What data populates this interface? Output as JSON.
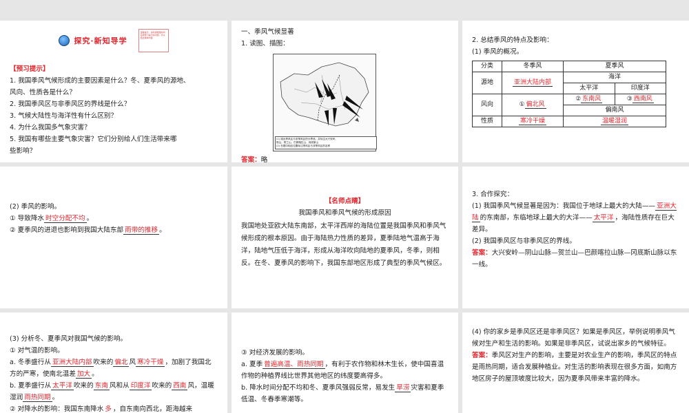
{
  "p1": {
    "title": "探究·新知导学",
    "note": "温馨提示：请利用较短时间完成预习提示的问题，可以结合课本内容",
    "section": "【预习提示】",
    "q": [
      "1. 我国季风气候形成的主要因素是什么？冬、夏季风的源地、",
      "风向、性质各是什么？",
      "2. 我国季风区与非季风区的界线是什么？",
      "3. 气候大陆性与海洋性有什么区别？",
      "4. 为什么我国多气象灾害？",
      "5. 我国有哪些主要气象灾害？它们分别给人们生活带来哪",
      "些影响？"
    ]
  },
  "p2": {
    "h1": "一、季风气候显著",
    "h2": "1. 读图、描图：",
    "map_note": [
      "(1) 描出季风区与非季风区的分界线，并标注大兴安岭、",
      "阴山、贺兰山、巴颜喀拉山、冈底斯山",
      "(2) 在图中相应位置标注季风区与非季风区的名称"
    ],
    "legend": [
      "夏季风",
      "冬季风"
    ],
    "ans_label": "答案：",
    "ans": "略"
  },
  "p3": {
    "h": "2. 总结季风的特点及影响：",
    "sub": "(1) 季风的概况。",
    "t": {
      "c0": "分类",
      "c1": "冬季风",
      "c2": "夏季风",
      "source": "源地",
      "src_w": "亚洲大陆内部",
      "ocean": "海洋",
      "pac": "太平洋",
      "ind": "印度洋",
      "dir": "风向",
      "n1": "①",
      "dir_w": "偏北风",
      "n2": "②",
      "dir_p": "东南风",
      "n3": "③",
      "dir_i": "西南风",
      "dir_s": "偏南风",
      "nature": "性质",
      "nat_w": "寒冷干燥",
      "nat_s": "温暖湿润"
    }
  },
  "p4": {
    "h": "(2) 季风的影响。",
    "l1a": "① 导致降水",
    "l1b": "时空分配不均",
    "l1c": "。",
    "l2a": "② 夏季风的进退也影响到我国大陆东部",
    "l2b": "雨带的推移",
    "l2c": "。"
  },
  "p5": {
    "h": "【名师点睛】",
    "title": "我国季风和季风气候的形成原因",
    "body": "我国地处亚欧大陆东南部，太平洋西岸的海陆位置是我国季风和季风气候形成的根本原因。由于海陆热力性质的差异，夏季陆地气温高于海洋，陆地气压低于海洋，形成从海洋吹向陆地的夏季风，冬季，则相反。在冬、夏季风的影响下，我国东部地区形成了典型的季风气候区。"
  },
  "p6": {
    "h": "3. 合作探究：",
    "q1a": "(1) 我国季风气候显著是因为：我国位于地球上最大的大陆——",
    "q1b": "亚洲大陆",
    "q1c": "的东南部，东临地球上最大的大洋——",
    "q1d": "太平洋",
    "q1e": "，海陆性质存在巨大差异。",
    "q2": "(2) 我国季风区与非季风区的界线。",
    "ans_label": "答案：",
    "ans": "大兴安岭—阴山山脉—贺兰山—巴颜喀拉山脉—冈底斯山脉以东一线。"
  },
  "p7": {
    "h": "(3) 分析冬、夏季风对我国气候的影响。",
    "s1": "① 对气温的影响。",
    "a1": "a. 冬季盛行从",
    "a2": "亚洲大陆内部",
    "a3": "吹来的",
    "a4": "偏北",
    "a5": "风",
    "a6": "寒冷干燥",
    "a7": "，加剧了我国北方的严寒，使南北温差",
    "a8": "加大",
    "a9": "。",
    "b1": "b. 夏季盛行从",
    "b2": "太平洋",
    "b3": "吹来的",
    "b4": "东南",
    "b5": "风和从",
    "b6": "印度洋",
    "b7": "吹来的",
    "b8": "西南",
    "b9": "风，温暖湿润",
    "b10": "雨热同期",
    "b11": "。",
    "c1": "② 对降水的影响：我国东南降水",
    "c2": "多",
    "c3": "，自东南向西北，距海越来"
  },
  "p8": {
    "s": "③ 对经济发展的影响。",
    "a1": "a. 夏季",
    "a2": "普遍高温、雨热同期",
    "a3": "，有利于农作物和林木生长，使中国喜温作物的种植界线比世界其他地区的纬度要高得多。",
    "b1": "b. 降水时间分配不均和冬、夏季风强弱反常，易发生",
    "b2": "旱涝",
    "b3": "灾害和夏季低温、冬春季寒潮等。"
  },
  "p9": {
    "q": "(4) 你的家乡是季风区还是非季风区？如果是季风区，举例说明季风气候对生产和生活的影响。如果是非季风区，试说出家乡的气候特征。",
    "ans_label": "答案：",
    "ans": "季风区对生产的影响，主要是对农业生产的影响，季风区的特点是雨热同期，适合发展种植业。对生活的影响表现在很多方面，如南方地区房子的屋顶坡度比较大，因为夏季风带来丰富的降水。"
  }
}
